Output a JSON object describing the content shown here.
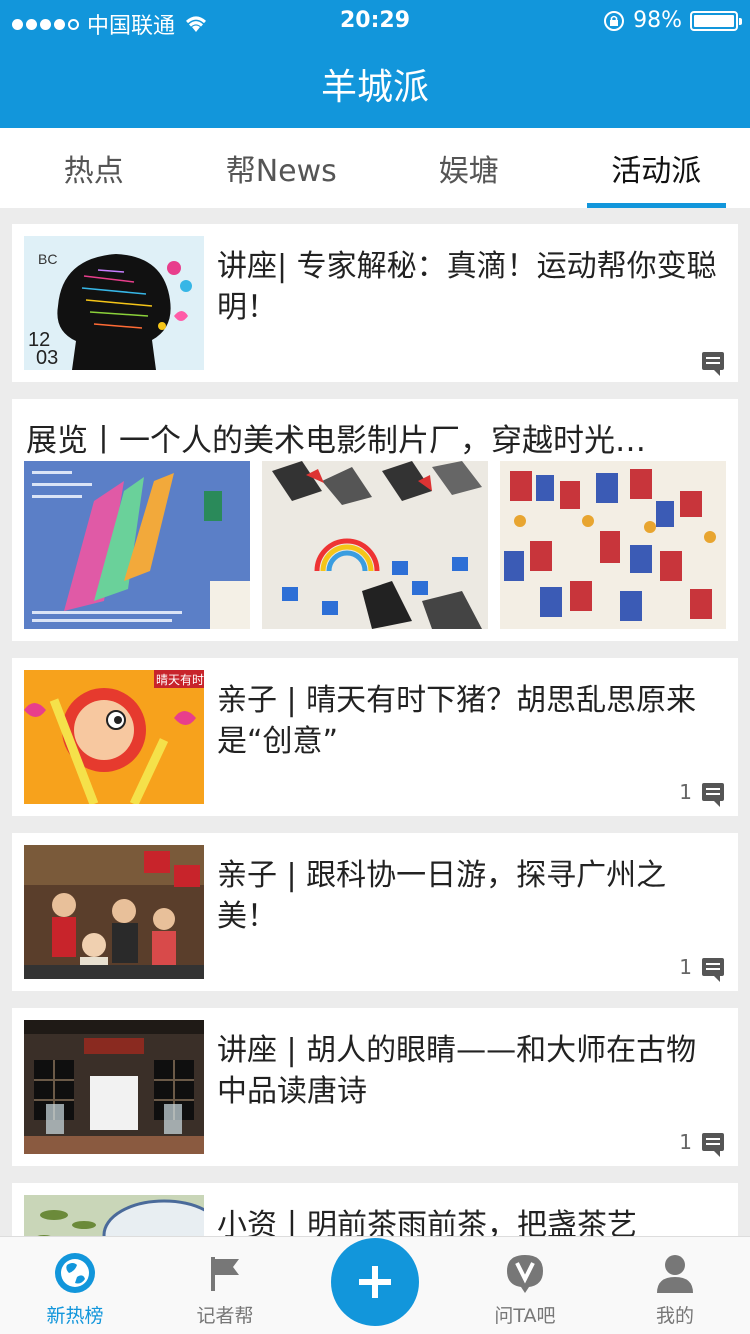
{
  "status_bar": {
    "carrier": "中国联通",
    "time": "20:29",
    "battery": "98%",
    "battery_level": 0.98
  },
  "nav": {
    "title": "羊城派"
  },
  "tabs": [
    {
      "label": "热点",
      "active": false
    },
    {
      "label": "帮News",
      "active": false
    },
    {
      "label": "娱塘",
      "active": false
    },
    {
      "label": "活动派",
      "active": true
    }
  ],
  "articles": [
    {
      "title": "讲座|  专家解秘：真滴！运动帮你变聪明！",
      "comments": ""
    },
    {
      "title": "展览丨一个人的美术电影制片厂，穿越时光…",
      "comments": ""
    },
    {
      "title": "亲子 | 晴天有时下猪？胡思乱思原来是“创意”",
      "comments": "1"
    },
    {
      "title": "亲子 | 跟科协一日游，探寻广州之美！",
      "comments": "1"
    },
    {
      "title": "讲座 | 胡人的眼睛——和大师在古物中品读唐诗",
      "comments": "1"
    },
    {
      "title": "小资丨明前茶雨前茶，把盏茶艺",
      "comments": ""
    }
  ],
  "tabbar": {
    "items": [
      {
        "label": "新热榜",
        "icon": "globe-icon",
        "active": true
      },
      {
        "label": "记者帮",
        "icon": "flag-icon",
        "active": false
      },
      {
        "label": "",
        "icon": "plus-icon",
        "active": false
      },
      {
        "label": "问TA吧",
        "icon": "chat-v-icon",
        "active": false
      },
      {
        "label": "我的",
        "icon": "person-icon",
        "active": false
      }
    ]
  },
  "colors": {
    "accent": "#1296db",
    "background": "#ececec"
  }
}
